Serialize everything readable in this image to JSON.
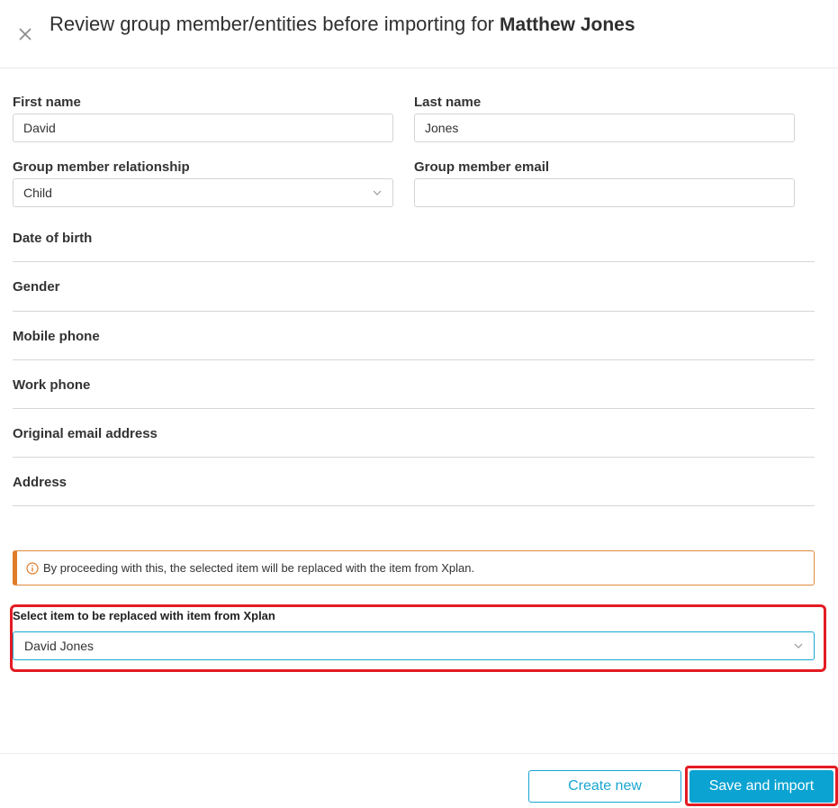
{
  "dialog": {
    "title": "Review group member/entities before importing for",
    "client_name": "Matthew Jones"
  },
  "form": {
    "first_name_label": "First name",
    "first_name_value": "David",
    "last_name_label": "Last name",
    "last_name_value": "Jones",
    "relationship_label": "Group member relationship",
    "relationship_value": "Child",
    "email_label": "Group member email",
    "email_value": "",
    "rows": [
      "Date of birth",
      "Gender",
      "Mobile phone",
      "Work phone",
      "Original email address",
      "Address"
    ]
  },
  "alert": {
    "text": "By proceeding with this, the selected item will be replaced with the item from Xplan."
  },
  "replace": {
    "label": "Select item to be replaced with item from Xplan",
    "value": "David Jones"
  },
  "footer": {
    "create_new_label": "Create new",
    "save_import_label": "Save and import"
  },
  "colors": {
    "accent": "#0aa3d2",
    "warning": "#e07b27",
    "highlight": "#e31b23"
  }
}
